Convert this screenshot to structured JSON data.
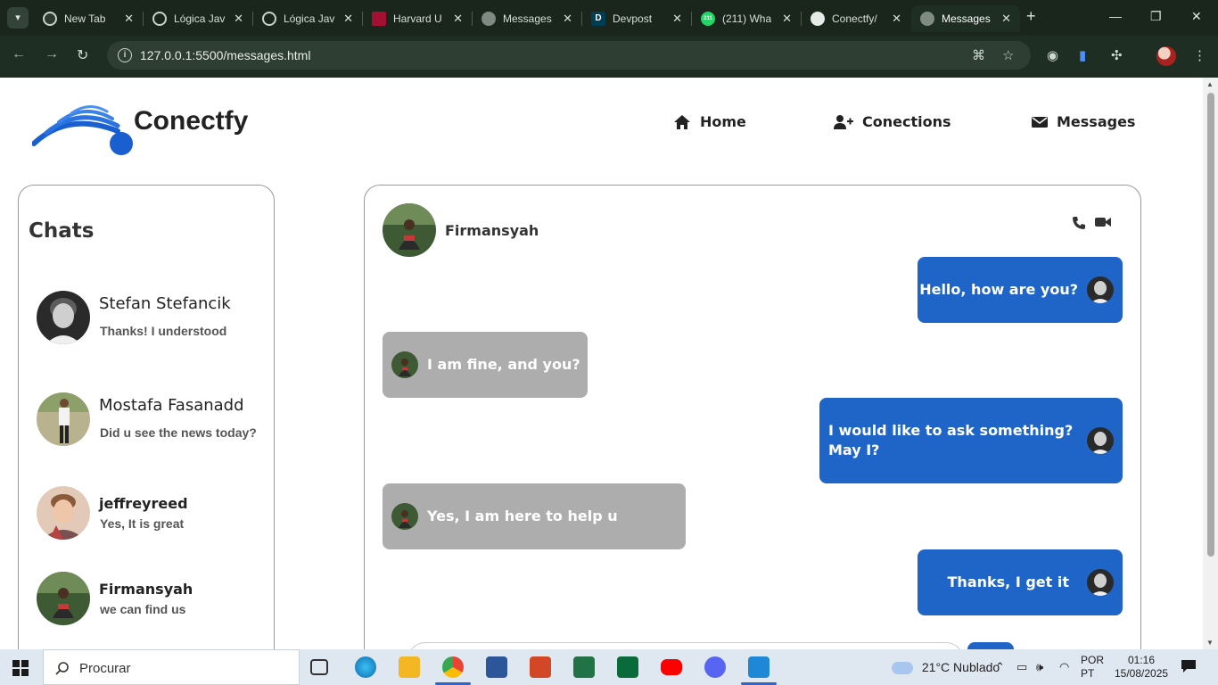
{
  "browser": {
    "tabs": [
      {
        "label": "New Tab",
        "icon": "chrome-icon"
      },
      {
        "label": "Lógica Jav",
        "icon": "openai-icon"
      },
      {
        "label": "Lógica Jav",
        "icon": "openai-icon"
      },
      {
        "label": "Harvard U",
        "icon": "harvard-icon"
      },
      {
        "label": "Messages",
        "icon": "globe-icon"
      },
      {
        "label": "Devpost",
        "icon": "devpost-icon",
        "icon_text": "D"
      },
      {
        "label": "(211) Wha",
        "icon": "whatsapp-icon",
        "icon_text": "211"
      },
      {
        "label": "Conectfy/",
        "icon": "github-icon"
      },
      {
        "label": "Messages",
        "icon": "globe-icon",
        "active": true
      }
    ],
    "url": "127.0.0.1:5500/messages.html"
  },
  "site": {
    "brand": "Conectfy",
    "nav": [
      {
        "label": "Home",
        "icon": "home-icon"
      },
      {
        "label": "Conections",
        "icon": "user-plus-icon"
      },
      {
        "label": "Messages",
        "icon": "envelope-icon"
      }
    ]
  },
  "chats": {
    "title": "Chats",
    "items": [
      {
        "name": "Stefan Stefancik",
        "preview": "Thanks! I understood"
      },
      {
        "name": "Mostafa Fasanadd",
        "preview": "Did u see the news today?"
      },
      {
        "name": "jeffreyreed",
        "preview": "Yes, It is great"
      },
      {
        "name": "Firmansyah",
        "preview": "we can find us"
      }
    ]
  },
  "conversation": {
    "contact": "Firmansyah",
    "messages": [
      {
        "from": "me",
        "text": "Hello, how are you?"
      },
      {
        "from": "them",
        "text": "I am fine, and you?"
      },
      {
        "from": "me",
        "text": "I would like to ask something? May I?"
      },
      {
        "from": "them",
        "text": "Yes, I am here to help u"
      },
      {
        "from": "me",
        "text": "Thanks, I get it"
      }
    ]
  },
  "taskbar": {
    "search_placeholder": "Procurar",
    "weather": "21°C  Nublado",
    "lang_line1": "POR",
    "lang_line2": "PT",
    "time": "01:16",
    "date": "15/08/2025"
  },
  "colors": {
    "accent": "#1f65c8",
    "received_bubble": "#adadad",
    "browser_chrome": "#1f2e22"
  }
}
